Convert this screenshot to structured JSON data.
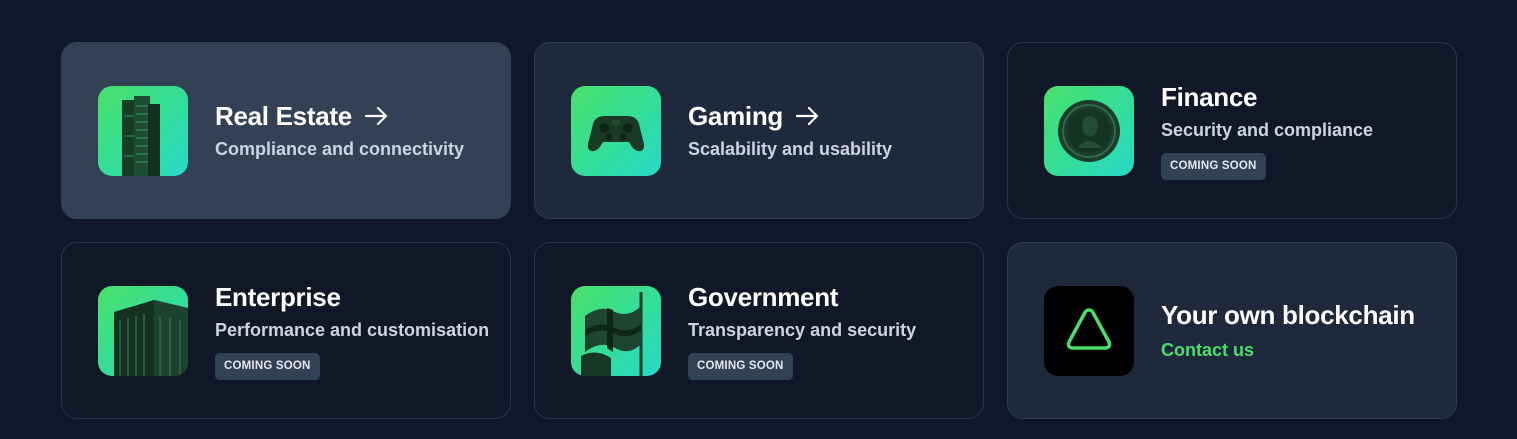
{
  "cards": [
    {
      "title": "Real Estate",
      "subtitle": "Compliance and connectivity",
      "image": "skyscraper-image"
    },
    {
      "title": "Gaming",
      "subtitle": "Scalability and usability",
      "image": "gamepad-image"
    },
    {
      "title": "Finance",
      "subtitle": "Security and compliance",
      "badge": "COMING SOON",
      "image": "coin-image"
    },
    {
      "title": "Enterprise",
      "subtitle": "Performance and customisation",
      "badge": "COMING SOON",
      "image": "server-rack-image"
    },
    {
      "title": "Government",
      "subtitle": "Transparency and security",
      "badge": "COMING SOON",
      "image": "flag-image"
    },
    {
      "title": "Your own blockchain",
      "link": "Contact us",
      "image": "triangle-logo"
    }
  ],
  "colors": {
    "page_background": "#0f1729",
    "card_background": "#101828",
    "card_hover_background": "#334155",
    "accent_green": "#4ade6a",
    "thumb_gradient": [
      "#4ae06a",
      "#28d9c9"
    ]
  },
  "icons": {
    "title_arrow": "arrow-right-icon"
  }
}
